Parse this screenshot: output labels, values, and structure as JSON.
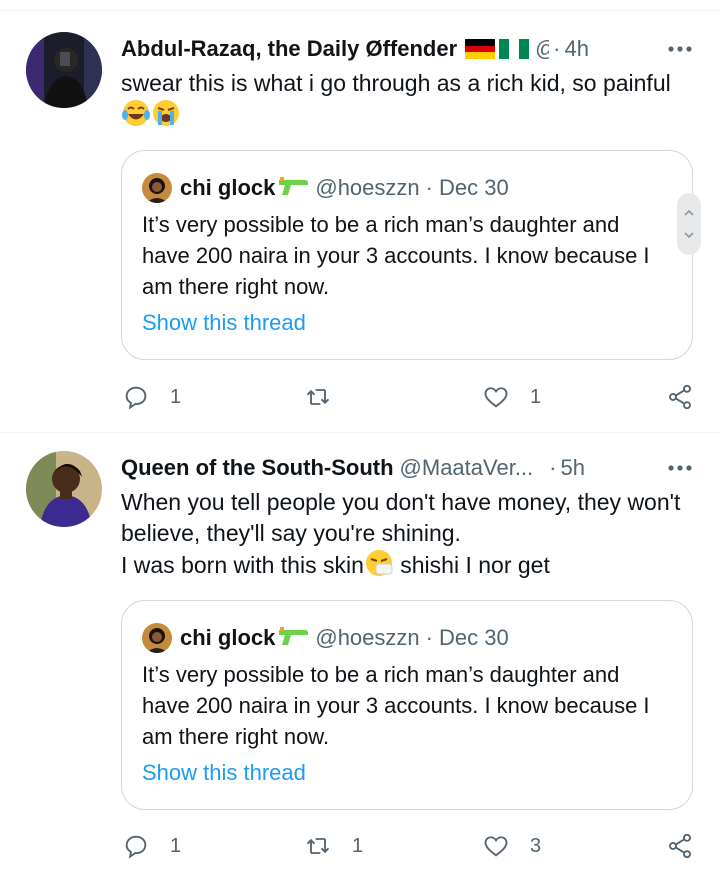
{
  "tweets": [
    {
      "name": "Abdul-Razaq, the Daily Øffender",
      "handle": "@",
      "time": "4h",
      "text": "swear this is what i go through as a rich kid, so painful",
      "emojis": [
        "face-with-tears-of-joy",
        "loudly-crying-face"
      ],
      "flags": [
        "germany",
        "nigeria"
      ],
      "quote": {
        "name": "chi glock",
        "handle": "@hoeszzn",
        "date": "Dec 30",
        "text": "It’s very possible to be a rich man’s daughter and have 200 naira in your 3 accounts. I know because I am there right now.",
        "link": "Show this thread"
      },
      "counts": {
        "reply": "1",
        "retweet": "",
        "like": "1"
      }
    },
    {
      "name": "Queen of the South-South",
      "handle": "@MaataVer...",
      "time": "5h",
      "text_line1": "When you tell people you don't have money, they won't believe,  they'll say you're shining.",
      "text_line2a": "I was born with this skin",
      "text_line2b": " shishi I nor get",
      "emojis": [
        "sneezing-face"
      ],
      "quote": {
        "name": "chi glock",
        "handle": "@hoeszzn",
        "date": "Dec 30",
        "text": "It’s very possible to be a rich man’s daughter and have 200 naira in your 3 accounts. I know because I am there right now.",
        "link": "Show this thread"
      },
      "counts": {
        "reply": "1",
        "retweet": "1",
        "like": "3"
      }
    }
  ],
  "icons": {
    "reply": "reply-icon",
    "retweet": "retweet-icon",
    "like": "heart-icon",
    "share": "share-icon",
    "more": "more-icon",
    "gun_emoji": "water-pistol-icon"
  },
  "colors": {
    "link": "#1d9bf0",
    "muted": "#536471",
    "border": "#cfd9de"
  }
}
